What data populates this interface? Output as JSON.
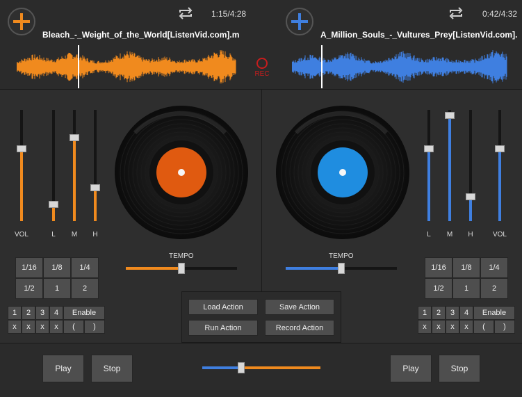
{
  "deck_left": {
    "time": "1:15/4:28",
    "track": "Bleach_-_Weight_of_the_World[ListenVid.com].m",
    "accent": "#f08a1e",
    "vinyl_label_color": "#e05a10",
    "sliders": [
      {
        "label": "VOL",
        "level": 0.65
      },
      {
        "label": "L",
        "level": 0.15
      },
      {
        "label": "M",
        "level": 0.75
      },
      {
        "label": "H",
        "level": 0.3
      }
    ],
    "tempo_label": "TEMPO",
    "tempo": 0.5,
    "beats_row1": [
      "1/16",
      "1/8",
      "1/4"
    ],
    "beats_row2": [
      "1/2",
      "1",
      "2"
    ],
    "loop_nums": [
      "1",
      "2",
      "3",
      "4"
    ],
    "enable": "Enable",
    "loop_x": [
      "x",
      "x",
      "x",
      "x"
    ],
    "paren_open": "(",
    "paren_close": ")",
    "play": "Play",
    "stop": "Stop"
  },
  "deck_right": {
    "time": "0:42/4:32",
    "track": "A_Million_Souls_-_Vultures_Prey[ListenVid.com].m",
    "accent": "#3f7fe0",
    "vinyl_label_color": "#1f8de0",
    "sliders": [
      {
        "label": "L",
        "level": 0.65
      },
      {
        "label": "M",
        "level": 0.95
      },
      {
        "label": "H",
        "level": 0.22
      },
      {
        "label": "VOL",
        "level": 0.65
      }
    ],
    "tempo_label": "TEMPO",
    "tempo": 0.5,
    "beats_row1": [
      "1/16",
      "1/8",
      "1/4"
    ],
    "beats_row2": [
      "1/2",
      "1",
      "2"
    ],
    "loop_nums": [
      "1",
      "2",
      "3",
      "4"
    ],
    "enable": "Enable",
    "loop_x": [
      "x",
      "x",
      "x",
      "x"
    ],
    "paren_open": "(",
    "paren_close": ")",
    "play": "Play",
    "stop": "Stop"
  },
  "rec_label": "REC",
  "actions": {
    "load": "Load Action",
    "save": "Save Action",
    "run": "Run Action",
    "record": "Record Action"
  },
  "crossfader": 0.33,
  "icons": {
    "add": "plus-icon",
    "loop": "repeat-icon",
    "record": "record-circle-icon"
  }
}
